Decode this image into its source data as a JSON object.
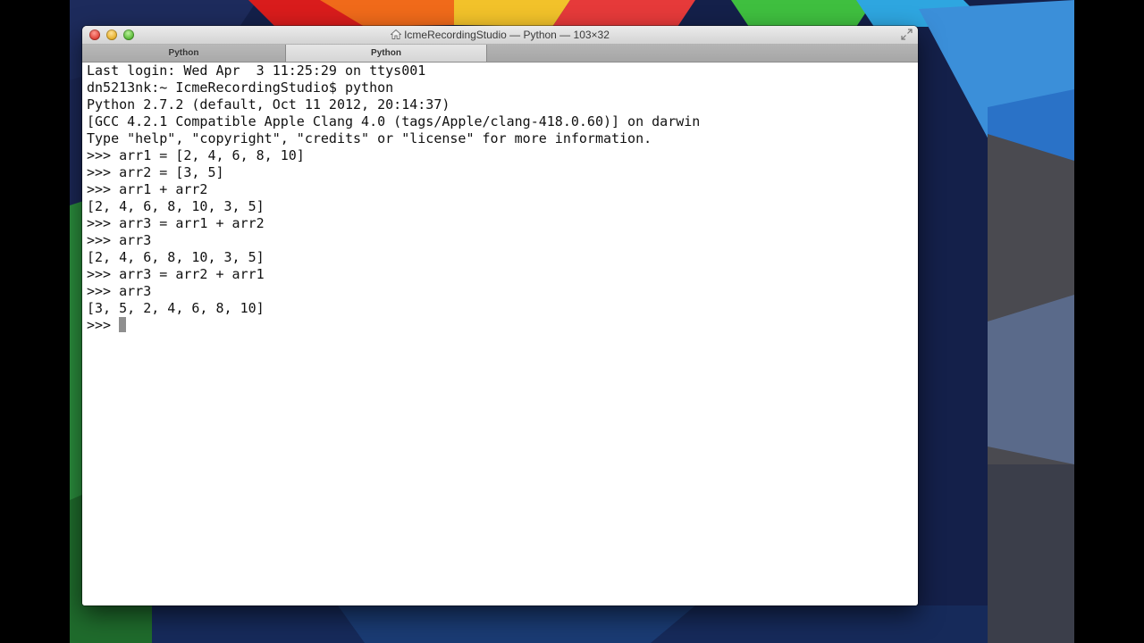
{
  "window": {
    "title": "IcmeRecordingStudio — Python — 103×32"
  },
  "tabs": [
    {
      "label": "Python"
    },
    {
      "label": "Python"
    }
  ],
  "terminal": {
    "lines": [
      "Last login: Wed Apr  3 11:25:29 on ttys001",
      "dn5213nk:~ IcmeRecordingStudio$ python",
      "Python 2.7.2 (default, Oct 11 2012, 20:14:37)",
      "[GCC 4.2.1 Compatible Apple Clang 4.0 (tags/Apple/clang-418.0.60)] on darwin",
      "Type \"help\", \"copyright\", \"credits\" or \"license\" for more information.",
      ">>> arr1 = [2, 4, 6, 8, 10]",
      ">>> arr2 = [3, 5]",
      ">>> arr1 + arr2",
      "[2, 4, 6, 8, 10, 3, 5]",
      ">>> arr3 = arr1 + arr2",
      ">>> arr3",
      "[2, 4, 6, 8, 10, 3, 5]",
      ">>> arr3 = arr2 + arr1",
      ">>> arr3",
      "[3, 5, 2, 4, 6, 8, 10]"
    ],
    "prompt": ">>> "
  }
}
